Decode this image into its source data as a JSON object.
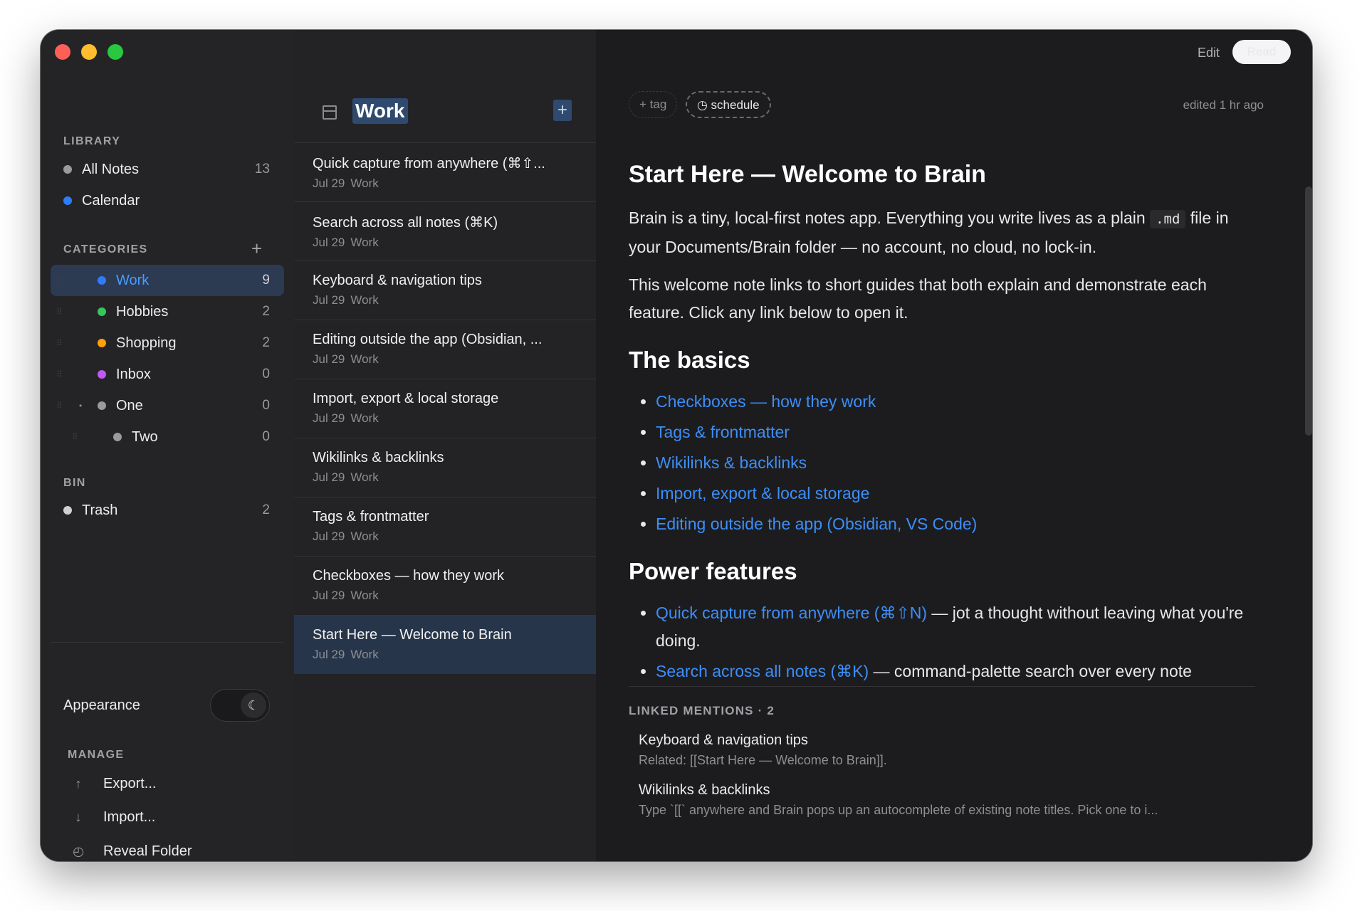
{
  "window": {
    "traffic_lights": [
      "close",
      "minimize",
      "zoom"
    ]
  },
  "sidebar": {
    "library_label": "LIBRARY",
    "library": [
      {
        "label": "All Notes",
        "count": "13",
        "color": "#9a9a9f"
      },
      {
        "label": "Calendar",
        "count": "",
        "color": "#2f7cf6"
      }
    ],
    "categories_label": "CATEGORIES",
    "add_category": "+",
    "categories": [
      {
        "label": "Work",
        "count": "9",
        "color": "#2f7cf6",
        "active": true
      },
      {
        "label": "Hobbies",
        "count": "2",
        "color": "#34c759"
      },
      {
        "label": "Shopping",
        "count": "2",
        "color": "#ff9f0a"
      },
      {
        "label": "Inbox",
        "count": "0",
        "color": "#bf5af2"
      },
      {
        "label": "One",
        "count": "0",
        "color": "#9a9a9f"
      },
      {
        "label": "Two",
        "count": "0",
        "color": "#9a9a9f"
      }
    ],
    "bin_label": "BIN",
    "bin": [
      {
        "label": "Trash",
        "count": "2",
        "color": "#d0d0d4"
      }
    ],
    "appearance_label": "Appearance",
    "appearance_icon": "moon-icon",
    "manage_label": "MANAGE",
    "manage": [
      {
        "label": "Export...",
        "icon": "↑"
      },
      {
        "label": "Import...",
        "icon": "↓"
      },
      {
        "label": "Reveal Folder",
        "icon": "◴"
      }
    ]
  },
  "list": {
    "title": "Work",
    "add_label": "+",
    "notes": [
      {
        "title": "Quick capture from anywhere (⌘⇧...",
        "date": "Jul 29",
        "category": "Work"
      },
      {
        "title": "Search across all notes (⌘K)",
        "date": "Jul 29",
        "category": "Work"
      },
      {
        "title": "Keyboard & navigation tips",
        "date": "Jul 29",
        "category": "Work"
      },
      {
        "title": "Editing outside the app (Obsidian, ...",
        "date": "Jul 29",
        "category": "Work"
      },
      {
        "title": "Import, export & local storage",
        "date": "Jul 29",
        "category": "Work"
      },
      {
        "title": "Wikilinks & backlinks",
        "date": "Jul 29",
        "category": "Work"
      },
      {
        "title": "Tags & frontmatter",
        "date": "Jul 29",
        "category": "Work"
      },
      {
        "title": "Checkboxes — how they work",
        "date": "Jul 29",
        "category": "Work"
      },
      {
        "title": "Start Here — Welcome to Brain",
        "date": "Jul 29",
        "category": "Work",
        "selected": true
      }
    ]
  },
  "editor": {
    "mode_edit": "Edit",
    "mode_read": "Read",
    "tag_chip": "+ tag",
    "schedule_chip": "◷ schedule",
    "edited": "edited 1 hr ago",
    "title": "Start Here — Welcome to Brain",
    "p1_a": "Brain is a tiny, local-first notes app. Everything you write lives as a plain ",
    "p1_code": ".md",
    "p1_b": " file in your Documents/Brain folder — no account, no cloud, no lock-in.",
    "p2": "This welcome note links to short guides that both explain and demonstrate each feature. Click any link below to open it.",
    "h_basics": "The basics",
    "basics": [
      "Checkboxes — how they work",
      "Tags & frontmatter",
      "Wikilinks & backlinks",
      "Import, export & local storage",
      "Editing outside the app (Obsidian, VS Code)"
    ],
    "h_power": "Power features",
    "power": [
      {
        "link": "Quick capture from anywhere (⌘⇧N)",
        "text": " — jot a thought without leaving what you're doing."
      },
      {
        "link": "Search across all notes (⌘K)",
        "text": " — command-palette search over every note"
      }
    ],
    "mentions_label": "LINKED MENTIONS · 2",
    "mentions": [
      {
        "title": "Keyboard & navigation tips",
        "snippet": "Related: [[Start Here — Welcome to Brain]]."
      },
      {
        "title": "Wikilinks & backlinks",
        "snippet": "Type `[[` anywhere and Brain pops up an autocomplete of existing note titles. Pick one to i..."
      }
    ]
  }
}
